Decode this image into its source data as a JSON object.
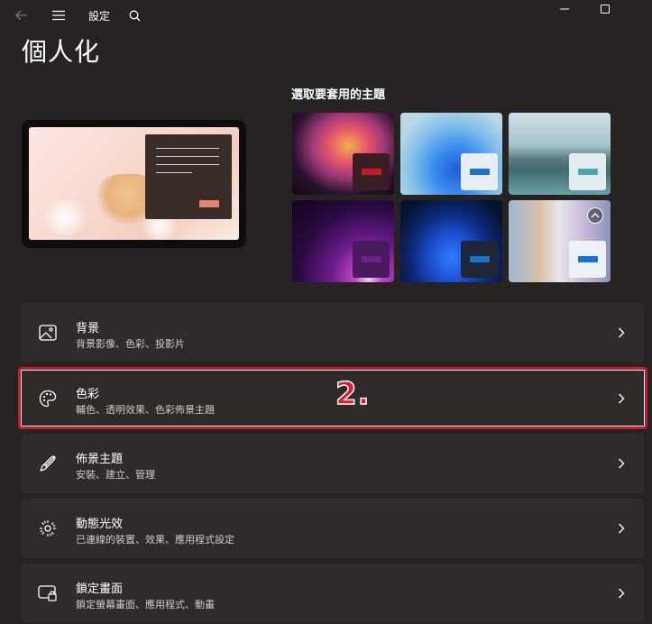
{
  "titlebar": {
    "title": "設定",
    "back_icon": "back-arrow-icon",
    "menu_icon": "hamburger-menu-icon",
    "search_icon": "search-icon",
    "minimize_icon": "minimize-icon",
    "maximize_icon": "maximize-icon"
  },
  "page": {
    "title": "個人化"
  },
  "themes": {
    "heading": "選取要套用的主題",
    "items": [
      {
        "name": "glow",
        "accent": "#c41c26"
      },
      {
        "name": "windows-light",
        "accent": "#1a73c9"
      },
      {
        "name": "captured-motion",
        "accent": "#4ba7b4"
      },
      {
        "name": "flow",
        "accent": "#6e1f8a"
      },
      {
        "name": "windows-dark",
        "accent": "#1a73c9"
      },
      {
        "name": "contrast-theme",
        "accent": "#1a73c9"
      }
    ]
  },
  "cards": [
    {
      "title": "背景",
      "subtitle": "背景影像、色彩、投影片",
      "icon": "image-icon"
    },
    {
      "title": "色彩",
      "subtitle": "輔色、透明效果、色彩佈景主題",
      "icon": "palette-icon"
    },
    {
      "title": "佈景主題",
      "subtitle": "安裝、建立、管理",
      "icon": "brush-icon"
    },
    {
      "title": "動態光效",
      "subtitle": "已連線的裝置、效果、應用程式設定",
      "icon": "dynamic-lighting-icon"
    },
    {
      "title": "鎖定畫面",
      "subtitle": "鎖定螢幕畫面、應用程式、動畫",
      "icon": "lock-screen-icon"
    }
  ],
  "annotation": {
    "label": "2.",
    "color": "#c8192a"
  }
}
